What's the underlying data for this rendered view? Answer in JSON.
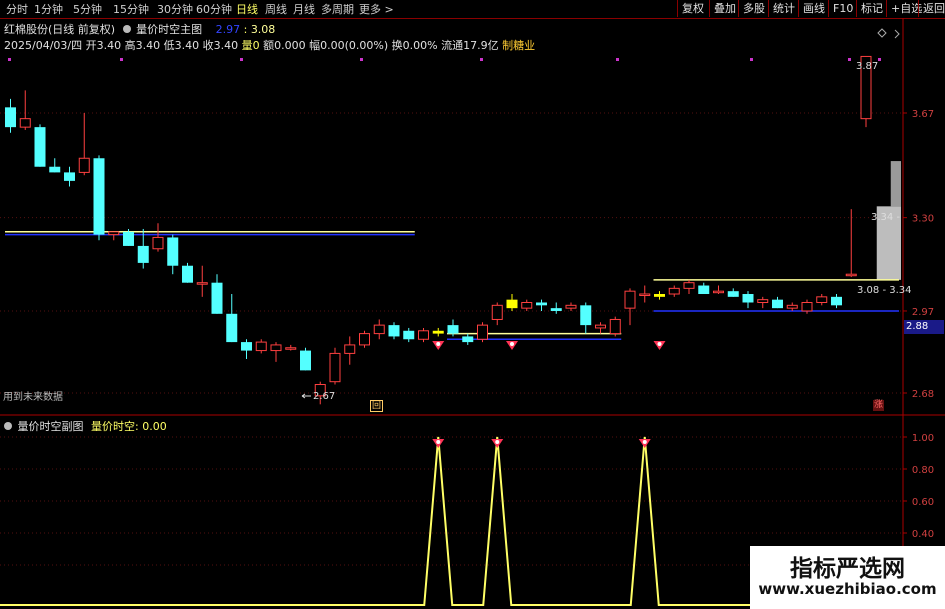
{
  "toolbar": {
    "timeframes": [
      "分时",
      "1分钟",
      "5分钟",
      "15分钟",
      "30分钟",
      "60分钟",
      "日线",
      "周线",
      "月线",
      "多周期",
      "更多 >"
    ],
    "active": "日线",
    "right_buttons": [
      "复权",
      "叠加",
      "多股",
      "统计",
      "画线",
      "F10",
      "标记",
      "+自选",
      "返回"
    ]
  },
  "header": {
    "stock": "红棉股份(日线 前复权)",
    "indicator": "量价时空主图",
    "ind_val1": "2.97",
    "ind_val2": "3.08",
    "date": "2025/04/03/四",
    "open_l": "开",
    "open": "3.40",
    "high_l": "高",
    "high": "3.40",
    "low_l": "低",
    "low": "3.40",
    "close_l": "收",
    "close": "3.40",
    "vol_l": "量",
    "vol": "0",
    "amt_l": "额",
    "amt": "0.000",
    "amp_l": "幅",
    "amp": "0.00(0.00%)",
    "turn_l": "换",
    "turn": "0.00%",
    "float_l": "流通",
    "float": "17.9亿",
    "sector": "制糖业"
  },
  "annotations": {
    "future_data": "用到未来数据",
    "low_price": "2.67",
    "high_price": "3.87",
    "range1": "3.34 -",
    "range2": "3.08 - 3.34",
    "current_price": "2.88",
    "marker_left": "回",
    "marker_right": "涨"
  },
  "sub_header": {
    "indicator": "量价时空副图",
    "label": "量价时空:",
    "value": "0.00"
  },
  "watermark": {
    "title": "指标严选网",
    "url": "www.xuezhibiao.com"
  },
  "colors": {
    "up": "#ff4040",
    "down": "#54ffff",
    "yellow": "#ffff00",
    "gray_box": "#bdbdbd",
    "blue_line": "#2233ff",
    "axis": "#aa0000"
  },
  "chart_data": [
    {
      "type": "candlestick",
      "title": "量价时空主图",
      "y_ticks": [
        "3.67",
        "3.30",
        "2.97",
        "2.68"
      ],
      "ylim": [
        2.56,
        4.0
      ],
      "candles": [
        {
          "o": 3.69,
          "h": 3.72,
          "l": 3.6,
          "c": 3.62
        },
        {
          "o": 3.62,
          "h": 3.75,
          "l": 3.61,
          "c": 3.65
        },
        {
          "o": 3.62,
          "h": 3.63,
          "l": 3.48,
          "c": 3.48
        },
        {
          "o": 3.48,
          "h": 3.51,
          "l": 3.46,
          "c": 3.46
        },
        {
          "o": 3.46,
          "h": 3.48,
          "l": 3.41,
          "c": 3.43
        },
        {
          "o": 3.46,
          "h": 3.67,
          "l": 3.45,
          "c": 3.51
        },
        {
          "o": 3.51,
          "h": 3.52,
          "l": 3.22,
          "c": 3.24
        },
        {
          "o": 3.24,
          "h": 3.25,
          "l": 3.22,
          "c": 3.25
        },
        {
          "o": 3.25,
          "h": 3.26,
          "l": 3.2,
          "c": 3.2
        },
        {
          "o": 3.2,
          "h": 3.26,
          "l": 3.12,
          "c": 3.14
        },
        {
          "o": 3.19,
          "h": 3.28,
          "l": 3.18,
          "c": 3.23
        },
        {
          "o": 3.23,
          "h": 3.24,
          "l": 3.1,
          "c": 3.13
        },
        {
          "o": 3.13,
          "h": 3.14,
          "l": 3.07,
          "c": 3.07
        },
        {
          "o": 3.07,
          "h": 3.13,
          "l": 3.02,
          "c": 3.07
        },
        {
          "o": 3.07,
          "h": 3.1,
          "l": 2.96,
          "c": 2.96
        },
        {
          "o": 2.96,
          "h": 3.03,
          "l": 2.86,
          "c": 2.86
        },
        {
          "o": 2.86,
          "h": 2.87,
          "l": 2.8,
          "c": 2.83
        },
        {
          "o": 2.83,
          "h": 2.87,
          "l": 2.82,
          "c": 2.86
        },
        {
          "o": 2.83,
          "h": 2.86,
          "l": 2.79,
          "c": 2.85
        },
        {
          "o": 2.84,
          "h": 2.85,
          "l": 2.83,
          "c": 2.84
        },
        {
          "o": 2.83,
          "h": 2.84,
          "l": 2.76,
          "c": 2.76
        },
        {
          "o": 2.67,
          "h": 2.72,
          "l": 2.64,
          "c": 2.71
        },
        {
          "o": 2.72,
          "h": 2.84,
          "l": 2.71,
          "c": 2.82
        },
        {
          "o": 2.82,
          "h": 2.88,
          "l": 2.78,
          "c": 2.85
        },
        {
          "o": 2.85,
          "h": 2.9,
          "l": 2.84,
          "c": 2.89
        },
        {
          "o": 2.89,
          "h": 2.94,
          "l": 2.87,
          "c": 2.92
        },
        {
          "o": 2.92,
          "h": 2.93,
          "l": 2.87,
          "c": 2.88
        },
        {
          "o": 2.9,
          "h": 2.91,
          "l": 2.86,
          "c": 2.87
        },
        {
          "o": 2.87,
          "h": 2.91,
          "l": 2.86,
          "c": 2.9
        },
        {
          "o": 2.89,
          "h": 2.91,
          "l": 2.88,
          "c": 2.9
        },
        {
          "o": 2.92,
          "h": 2.94,
          "l": 2.88,
          "c": 2.89
        },
        {
          "o": 2.88,
          "h": 2.89,
          "l": 2.85,
          "c": 2.86
        },
        {
          "o": 2.87,
          "h": 2.93,
          "l": 2.86,
          "c": 2.92
        },
        {
          "o": 2.94,
          "h": 3.0,
          "l": 2.92,
          "c": 2.99
        },
        {
          "o": 3.01,
          "h": 3.03,
          "l": 2.97,
          "c": 2.98
        },
        {
          "o": 2.98,
          "h": 3.01,
          "l": 2.97,
          "c": 3.0
        },
        {
          "o": 3.0,
          "h": 3.01,
          "l": 2.97,
          "c": 2.99
        },
        {
          "o": 2.98,
          "h": 3.0,
          "l": 2.96,
          "c": 2.97
        },
        {
          "o": 2.98,
          "h": 3.0,
          "l": 2.97,
          "c": 2.99
        },
        {
          "o": 2.99,
          "h": 3.0,
          "l": 2.89,
          "c": 2.92
        },
        {
          "o": 2.91,
          "h": 2.93,
          "l": 2.89,
          "c": 2.92
        },
        {
          "o": 2.89,
          "h": 2.95,
          "l": 2.88,
          "c": 2.94
        },
        {
          "o": 2.98,
          "h": 3.05,
          "l": 2.92,
          "c": 3.04
        },
        {
          "o": 3.03,
          "h": 3.06,
          "l": 3.0,
          "c": 3.03
        },
        {
          "o": 3.03,
          "h": 3.04,
          "l": 3.01,
          "c": 3.02
        },
        {
          "o": 3.03,
          "h": 3.06,
          "l": 3.02,
          "c": 3.05
        },
        {
          "o": 3.05,
          "h": 3.08,
          "l": 3.03,
          "c": 3.07
        },
        {
          "o": 3.06,
          "h": 3.07,
          "l": 3.03,
          "c": 3.03
        },
        {
          "o": 3.04,
          "h": 3.06,
          "l": 3.03,
          "c": 3.04
        },
        {
          "o": 3.04,
          "h": 3.05,
          "l": 3.02,
          "c": 3.02
        },
        {
          "o": 3.03,
          "h": 3.04,
          "l": 2.98,
          "c": 3.0
        },
        {
          "o": 3.0,
          "h": 3.02,
          "l": 2.98,
          "c": 3.01
        },
        {
          "o": 3.01,
          "h": 3.02,
          "l": 2.98,
          "c": 2.98
        },
        {
          "o": 2.98,
          "h": 3.0,
          "l": 2.97,
          "c": 2.99
        },
        {
          "o": 2.97,
          "h": 3.01,
          "l": 2.96,
          "c": 3.0
        },
        {
          "o": 3.0,
          "h": 3.03,
          "l": 2.99,
          "c": 3.02
        },
        {
          "o": 3.02,
          "h": 3.03,
          "l": 2.98,
          "c": 2.99
        },
        {
          "o": 3.1,
          "h": 3.33,
          "l": 3.09,
          "c": 3.1
        },
        {
          "o": 3.65,
          "h": 3.87,
          "l": 3.62,
          "c": 3.87
        }
      ],
      "yellow_candles": [
        29,
        34,
        44
      ],
      "signals": [
        29,
        34,
        44
      ],
      "support_lines": [
        {
          "value": 3.25,
          "from": 0,
          "to": 27,
          "color": "#ffff99"
        },
        {
          "value": 3.24,
          "from": 0,
          "to": 27,
          "color": "#2233ff"
        },
        {
          "value": 2.89,
          "from": 30,
          "to": 41,
          "color": "#ffff99"
        },
        {
          "value": 2.87,
          "from": 30,
          "to": 41,
          "color": "#2233ff"
        },
        {
          "value": 3.08,
          "from": 44,
          "to": 62,
          "color": "#ffff99"
        },
        {
          "value": 2.97,
          "from": 44,
          "to": 62,
          "color": "#2233ff"
        }
      ],
      "gray_box": {
        "from": 59,
        "to": 61,
        "low": 3.08,
        "high": 3.34,
        "mid": 3.5
      }
    },
    {
      "type": "line",
      "title": "量价时空副图",
      "series": [
        {
          "name": "量价时空",
          "values_at_index": [
            [
              29,
              1.0
            ],
            [
              33,
              1.0
            ],
            [
              43,
              1.0
            ]
          ]
        }
      ],
      "baseline": 0,
      "y_ticks": [
        "1.00",
        "0.80",
        "0.60",
        "0.40",
        "0.20"
      ],
      "ylim": [
        0,
        1.0
      ]
    }
  ]
}
